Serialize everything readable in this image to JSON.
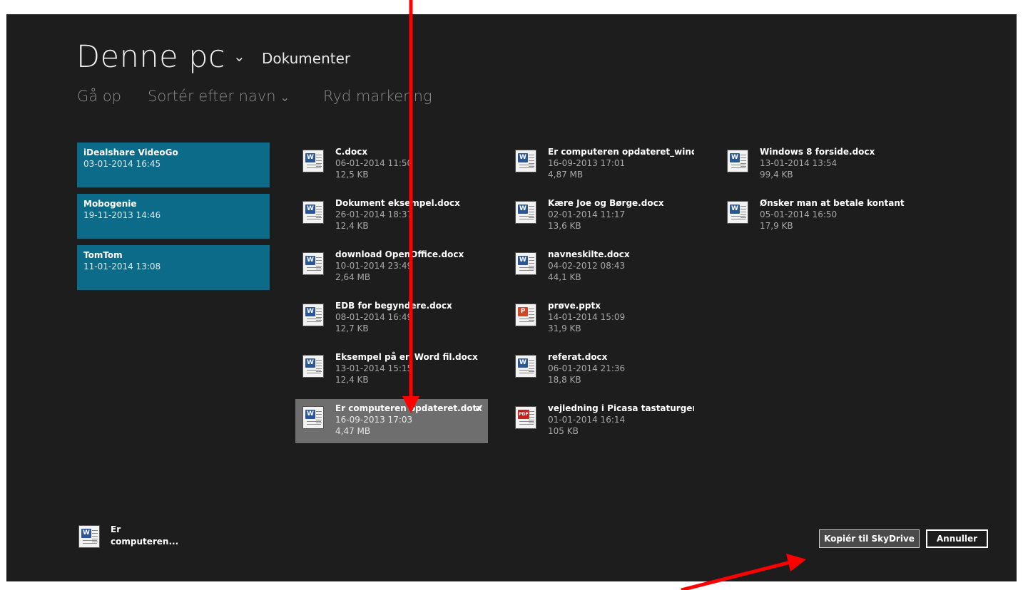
{
  "header": {
    "location": "Denne pc",
    "subfolder": "Dokumenter"
  },
  "commands": {
    "up": "Gå op",
    "sort": "Sortér efter navn",
    "clear": "Ryd markering"
  },
  "folders": [
    {
      "name": "iDealshare VideoGo",
      "date": "03-01-2014 16:45"
    },
    {
      "name": "Mobogenie",
      "date": "19-11-2013 14:46"
    },
    {
      "name": "TomTom",
      "date": "11-01-2014 13:08"
    }
  ],
  "files": [
    {
      "name": "C.docx",
      "date": "06-01-2014 11:50",
      "size": "12,5 KB",
      "icon": "word-document-icon"
    },
    {
      "name": "Dokument eksempel.docx",
      "date": "26-01-2014 18:37",
      "size": "12,4 KB",
      "icon": "word-document-icon"
    },
    {
      "name": "download OpenOffice.docx",
      "date": "10-01-2014 23:49",
      "size": "2,64 MB",
      "icon": "word-document-icon"
    },
    {
      "name": "EDB for begyndere.docx",
      "date": "08-01-2014 16:49",
      "size": "12,7 KB",
      "icon": "word-document-icon"
    },
    {
      "name": "Eksempel på en Word fil.docx",
      "date": "13-01-2014 15:15",
      "size": "12,4 KB",
      "icon": "word-document-icon"
    },
    {
      "name": "Er computeren opdateret.dotx",
      "date": "16-09-2013 17:03",
      "size": "4,47 MB",
      "icon": "word-template-icon"
    },
    {
      "name": "Er computeren opdateret_wind...",
      "date": "16-09-2013 17:01",
      "size": "4,87 MB",
      "icon": "word-document-icon"
    },
    {
      "name": "Kære Joe og Børge.docx",
      "date": "02-01-2014 11:17",
      "size": "13,6 KB",
      "icon": "word-document-icon"
    },
    {
      "name": "navneskilte.docx",
      "date": "04-02-2012 08:43",
      "size": "44,1 KB",
      "icon": "word-document-icon"
    },
    {
      "name": "prøve.pptx",
      "date": "14-01-2014 15:09",
      "size": "31,9 KB",
      "icon": "powerpoint-icon"
    },
    {
      "name": "referat.docx",
      "date": "06-01-2014 21:36",
      "size": "18,8 KB",
      "icon": "word-document-icon"
    },
    {
      "name": "vejledning i Picasa tastaturgenv...",
      "date": "01-01-2014 16:14",
      "size": "105 KB",
      "icon": "pdf-icon"
    },
    {
      "name": "Windows 8 forside.docx",
      "date": "13-01-2014 13:54",
      "size": "99,4 KB",
      "icon": "word-document-icon"
    },
    {
      "name": "Ønsker man at betale kontant p...",
      "date": "05-01-2014 16:50",
      "size": "17,9 KB",
      "icon": "word-document-icon"
    }
  ],
  "selected_file": "Er computeren opdateret.dotx",
  "basket": {
    "line1": "Er",
    "line2": "computeren..."
  },
  "buttons": {
    "copy": "Kopiér til SkyDrive",
    "cancel": "Annuller"
  },
  "colors": {
    "background": "#1d1d1d",
    "folder_tile": "#0d6b8a",
    "selected_tile": "#6e6e6e",
    "annotation_arrow": "#ff0000",
    "word_badge": "#2b5797",
    "powerpoint_badge": "#d24726",
    "pdf_badge": "#cc1f1f"
  }
}
